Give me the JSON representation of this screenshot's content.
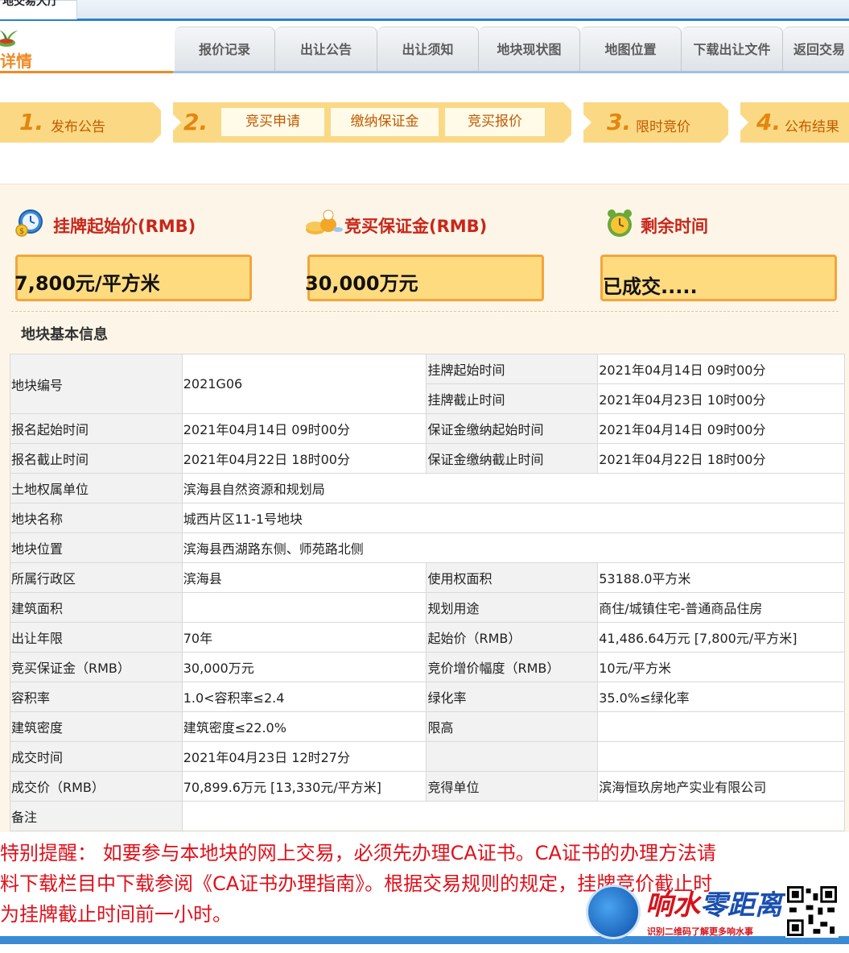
{
  "browser_tab": {
    "label": "地交易大厅"
  },
  "header": {
    "logo_text": "详情",
    "nav": [
      "报价记录",
      "出让公告",
      "出让须知",
      "地块现状图",
      "地图位置",
      "下载出让文件",
      "返回交易"
    ]
  },
  "steps": {
    "s1": {
      "num": "1.",
      "label": "发布公告"
    },
    "s2": {
      "num": "2.",
      "items": [
        "竞买申请",
        "缴纳保证金",
        "竞买报价"
      ]
    },
    "s3": {
      "num": "3.",
      "label": "限时竞价"
    },
    "s4": {
      "num": "4.",
      "label": "公布结果"
    }
  },
  "summary": {
    "start_price": {
      "title": "挂牌起始价(RMB)",
      "value": "7,800元/平方米",
      "icon": "money-clock-icon"
    },
    "deposit": {
      "title": "竞买保证金(RMB)",
      "value": "30,000万元",
      "icon": "coins-icon"
    },
    "remaining": {
      "title": "剩余时间",
      "value": "已成交.....",
      "icon": "alarm-clock-icon"
    }
  },
  "section_title": "地块基本信息",
  "table": {
    "r1": {
      "k": "地块编号",
      "v": "2021G06",
      "k2a": "挂牌起始时间",
      "v2a": "2021年04月14日 09时00分",
      "k2b": "挂牌截止时间",
      "v2b": "2021年04月23日 10时00分"
    },
    "r2": {
      "k": "报名起始时间",
      "v": "2021年04月14日 09时00分",
      "k2": "保证金缴纳起始时间",
      "v2": "2021年04月14日 09时00分"
    },
    "r3": {
      "k": "报名截止时间",
      "v": "2021年04月22日 18时00分",
      "k2": "保证金缴纳截止时间",
      "v2": "2021年04月22日 18时00分"
    },
    "r4": {
      "k": "土地权属单位",
      "v": "滨海县自然资源和规划局"
    },
    "r5": {
      "k": "地块名称",
      "v": "城西片区11-1号地块"
    },
    "r6": {
      "k": "地块位置",
      "v": "滨海县西湖路东侧、师苑路北侧"
    },
    "r7": {
      "k": "所属行政区",
      "v": "滨海县",
      "k2": "使用权面积",
      "v2": "53188.0平方米"
    },
    "r8": {
      "k": "建筑面积",
      "v": "",
      "k2": "规划用途",
      "v2": "商住/城镇住宅-普通商品住房"
    },
    "r9": {
      "k": "出让年限",
      "v": "70年",
      "k2": "起始价（RMB）",
      "v2": "41,486.64万元 [7,800元/平方米]"
    },
    "r10": {
      "k": "竞买保证金（RMB）",
      "v": "30,000万元",
      "k2": "竞价增价幅度（RMB）",
      "v2": "10元/平方米"
    },
    "r11": {
      "k": "容积率",
      "v": "1.0<容积率≤2.4",
      "k2": "绿化率",
      "v2": "35.0%≤绿化率"
    },
    "r12": {
      "k": "建筑密度",
      "v": "建筑密度≤22.0%",
      "k2": "限高",
      "v2": ""
    },
    "r13": {
      "k": "成交时间",
      "v": "2021年04月23日 12时27分",
      "k2": "",
      "v2": ""
    },
    "r14": {
      "k": "成交价（RMB）",
      "v": "70,899.6万元 [13,330元/平方米]",
      "k2": "竞得单位",
      "v2": "滨海恒玖房地产实业有限公司"
    },
    "r15": {
      "k": "备注",
      "v": ""
    }
  },
  "notice": {
    "line1": "特别提醒：  如要参与本地块的网上交易，必须先办理CA证书。CA证书的办理方法请",
    "line2": "料下载栏目中下载参阅《CA证书办理指南》。根据交易规则的规定，挂牌竞价截止时",
    "line3": "为挂牌截止时间前一小时。"
  },
  "watermark": {
    "title_red": "响水",
    "title_blue": "零距离",
    "sub": "识别二维码了解更多响水事"
  },
  "colors": {
    "accent_orange": "#f08a24",
    "step_yellow": "#fbd984",
    "notice_red": "#e0101a",
    "blue_line": "#2b7fd0"
  }
}
